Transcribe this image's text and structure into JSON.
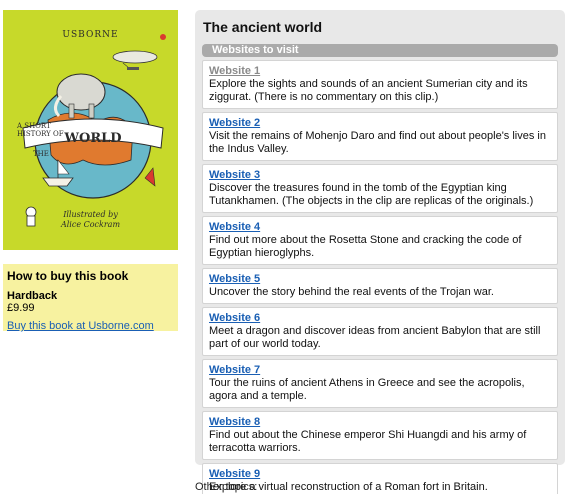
{
  "cover": {
    "brand": "USBORNE",
    "title_art": "A SHORT HISTORY OF THE WORLD",
    "credit_line1": "Illustrated by",
    "credit_line2": "Alice Cockram"
  },
  "buy": {
    "title": "How to buy this book",
    "format": "Hardback",
    "price": "£9.99",
    "link": "Buy this book at Usborne.com"
  },
  "panel": {
    "title": "The ancient world",
    "section_label": "Websites to visit",
    "websites": [
      {
        "label": "Website 1",
        "visited": true,
        "desc": "Explore the sights and sounds of an ancient Sumerian city and its ziggurat. (There is no commentary on this clip.)"
      },
      {
        "label": "Website 2",
        "visited": false,
        "desc": "Visit the remains of Mohenjo Daro and find out about people's lives in the Indus Valley."
      },
      {
        "label": "Website 3",
        "visited": false,
        "desc": "Discover the treasures found in the tomb of the Egyptian king Tutankhamen. (The objects in the clip are replicas of the originals.)"
      },
      {
        "label": "Website 4",
        "visited": false,
        "desc": "Find out more about the Rosetta Stone and cracking the code of Egyptian hieroglyphs."
      },
      {
        "label": "Website 5",
        "visited": false,
        "desc": "Uncover the story behind the real events of the Trojan war."
      },
      {
        "label": "Website 6",
        "visited": false,
        "desc": "Meet a dragon and discover ideas from ancient Babylon that are still part of our world today."
      },
      {
        "label": "Website 7",
        "visited": false,
        "desc": "Tour the ruins of ancient Athens in Greece and see the acropolis, agora and a temple."
      },
      {
        "label": "Website 8",
        "visited": false,
        "desc": "Find out about the Chinese emperor Shi Huangdi and his army of terracotta warriors."
      },
      {
        "label": "Website 9",
        "visited": false,
        "desc": "Explore a virtual reconstruction of a Roman fort in Britain."
      }
    ]
  },
  "other_topics": "Other topics:",
  "colors": {
    "cover_bg": "#c7d92a",
    "buy_bg": "#f7f2a0",
    "panel_bg": "#e8e8e8",
    "section_bar": "#aaaaaa",
    "link": "#1a5fb4",
    "visited_link": "#8a8a8a"
  }
}
